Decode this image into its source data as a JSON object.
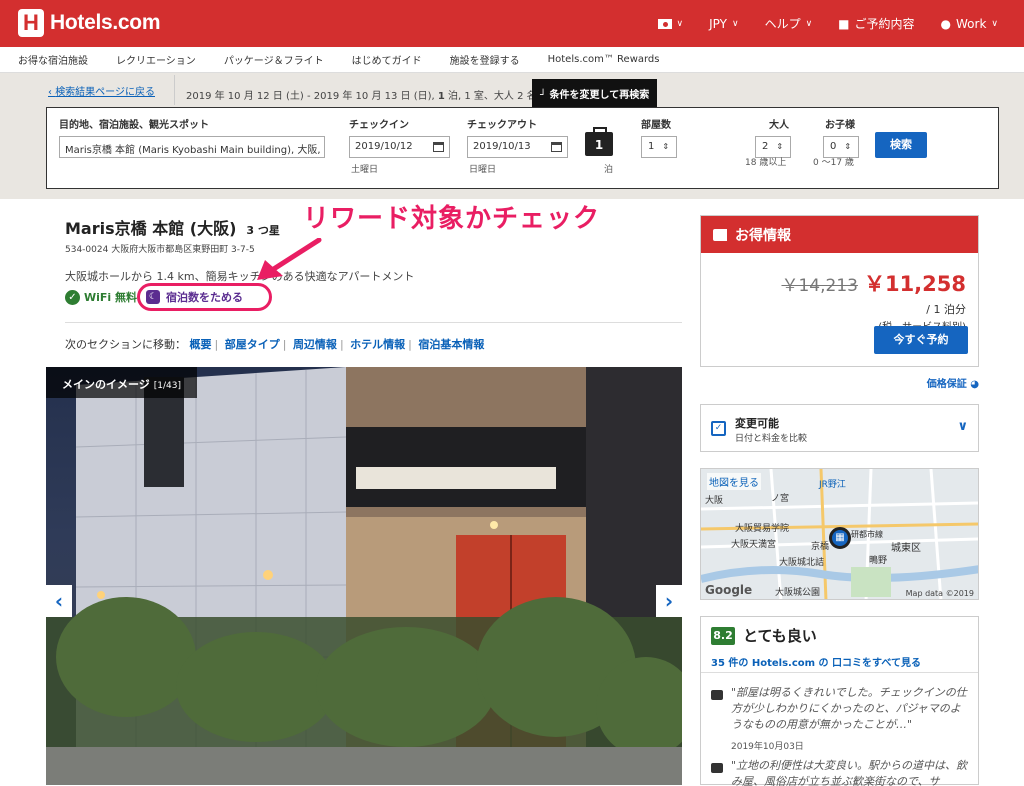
{
  "header": {
    "logo_text": "Hotels.com",
    "logo_letter": "H",
    "currency": "JPY",
    "help": "ヘルプ",
    "reservations": "ご予約内容",
    "account": "Work"
  },
  "subnav": [
    "お得な宿泊施設",
    "レクリエーション",
    "パッケージ＆フライト",
    "はじめてガイド",
    "施設を登録する",
    "Hotels.com™ Rewards"
  ],
  "searchbar": {
    "back_link": "検索結果ページに戻る",
    "summary_pre": "2019 年 10 月 12 日 (土) - 2019 年 10 月 13 日 (日), ",
    "summary_nights": "1",
    "summary_post": " 泊, 1 室、大人 2 名、",
    "modify": "条件を変更して再検索",
    "dest_label": "目的地、宿泊施設、観光スポット",
    "dest_value": "Maris京橋 本館 (Maris Kyobashi Main building), 大阪, 日本",
    "checkin_label": "チェックイン",
    "checkin_value": "2019/10/12",
    "checkin_day": "土曜日",
    "checkout_label": "チェックアウト",
    "checkout_value": "2019/10/13",
    "checkout_day": "日曜日",
    "nights": "1",
    "nights_unit": "泊",
    "rooms_label": "部屋数",
    "rooms_value": "1",
    "adults_label": "大人",
    "adults_value": "2",
    "adults_note": "18 歳以上",
    "children_label": "お子様",
    "children_value": "0",
    "children_note": "0 〜17 歳",
    "search_button": "検索"
  },
  "hotel": {
    "name": "Maris京橋 本館 (大阪)",
    "stars": "3 つ星",
    "address": "534-0024 大阪府大阪市都島区東野田町 3-7-5",
    "description": "大阪城ホールから 1.4 km、簡易キッチンのある快適なアパートメント",
    "wifi": "WiFi 無料",
    "reward": "宿泊数をためる",
    "annotation": "リワード対象かチェック",
    "jump_label": "次のセクションに移動：",
    "jump_links": [
      "概要",
      "部屋タイプ",
      "周辺情報",
      "ホテル情報",
      "宿泊基本情報"
    ],
    "photo_label": "メインのイメージ",
    "photo_count": "[1/43]"
  },
  "deal": {
    "title": "お得情報",
    "old_price": "￥14,213",
    "new_price": "￥11,258",
    "per_night": "/ 1 泊分",
    "tax_note": "(税、サービス料別)",
    "book_button": "今すぐ予約",
    "guarantee": "価格保証"
  },
  "flexible": {
    "title": "変更可能",
    "subtitle": "日付と料金を比較"
  },
  "map": {
    "title": "地図を見る",
    "labels": [
      "JR野江",
      "大阪",
      "ノ宮",
      "大阪貿易学院",
      "研都市線",
      "城東区",
      "大阪天満宮",
      "京橋",
      "大阪城北詰",
      "鴫野",
      "大阪城公園"
    ],
    "google": "Google",
    "credit": "Map data ©2019"
  },
  "reviews": {
    "score": "8.2",
    "label": "とても良い",
    "link": "35 件の Hotels.com の 口コミをすべて見る",
    "items": [
      {
        "text": "\"部屋は明るくきれいでした。チェックインの仕方が少しわかりにくかったのと、パジャマのようなものの用意が無かったことが…\"",
        "date": "2019年10月03日"
      },
      {
        "text": "\"立地の利便性は大変良い。駅からの道中は、飲み屋、風俗店が立ち並ぶ歓楽街なので、サ",
        "date": ""
      }
    ]
  },
  "colors": {
    "brand": "#d32f2f",
    "link": "#0a61b8",
    "button": "#1565c0",
    "annotation": "#e91e63",
    "rewards": "#5b2d90"
  }
}
